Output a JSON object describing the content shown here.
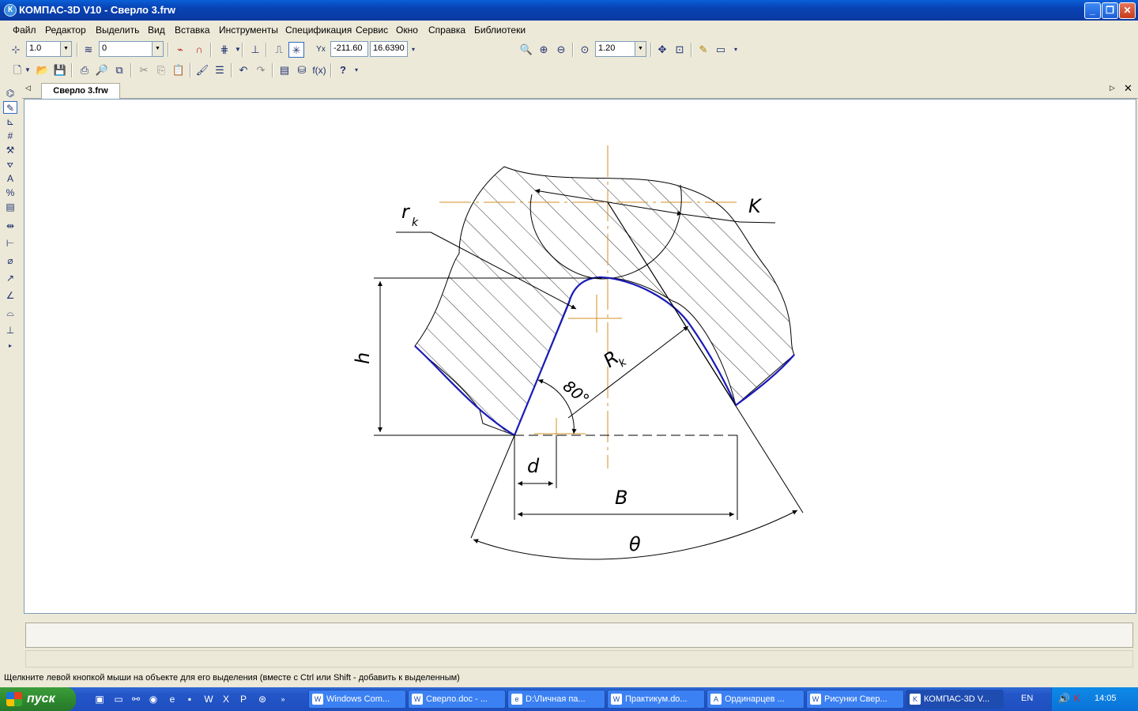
{
  "window": {
    "title": "КОМПАС-3D V10 - Сверло 3.frw",
    "app_icon": "К",
    "controls": {
      "minimize": "_",
      "restore": "❐",
      "close": "✕"
    }
  },
  "menu": [
    "Файл",
    "Редактор",
    "Выделить",
    "Вид",
    "Вставка",
    "Инструменты",
    "Спецификация",
    "Сервис",
    "Окно",
    "Справка",
    "Библиотеки"
  ],
  "toolbar1": {
    "step": "1.0",
    "layer": "0",
    "coord_x": "-211.60",
    "coord_y": "16.6390",
    "zoom": "1.20"
  },
  "doc_tab": "Сверло 3.frw",
  "drawing": {
    "labels": {
      "rk": "r",
      "rk_sub": "k",
      "K": "K",
      "h": "h",
      "Rk": "R",
      "Rk_sub": "k",
      "angle": "80°",
      "d": "d",
      "B": "B",
      "theta": "θ"
    },
    "colors": {
      "contour": "#1a1ab8",
      "axis": "#d09020",
      "line": "#000000"
    }
  },
  "status_text": "Щелкните левой кнопкой мыши на объекте для его выделения (вместе с Ctrl или Shift - добавить к выделенным)",
  "taskbar": {
    "start": "пуск",
    "tasks": [
      {
        "label": "Windows Com...",
        "icon": "W"
      },
      {
        "label": "Сверло.doc - ...",
        "icon": "W"
      },
      {
        "label": "D:\\Личная па...",
        "icon": "e"
      },
      {
        "label": "Практикум.do...",
        "icon": "W"
      },
      {
        "label": "Ординарцев ...",
        "icon": "A"
      },
      {
        "label": "Рисунки Свер...",
        "icon": "W"
      },
      {
        "label": "КОМПАС-3D V...",
        "icon": "K"
      }
    ],
    "lang": "EN",
    "clock": "14:05"
  }
}
